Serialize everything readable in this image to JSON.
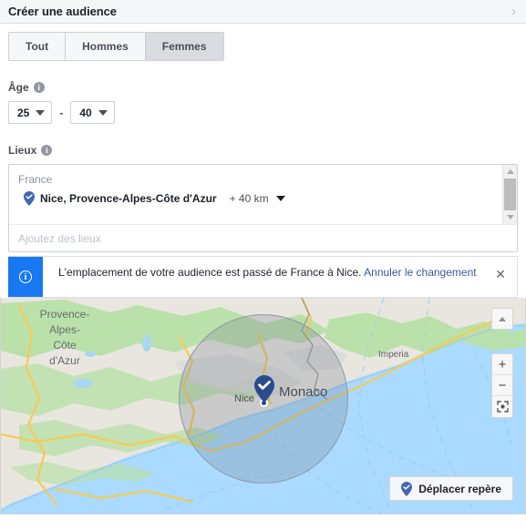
{
  "header": {
    "title": "Créer une audience",
    "expand_icon": "chevron-right-icon",
    "chevron": "›"
  },
  "gender_tabs": {
    "items": [
      {
        "label": "Tout",
        "active": false
      },
      {
        "label": "Hommes",
        "active": false
      },
      {
        "label": "Femmes",
        "active": true
      }
    ]
  },
  "age": {
    "label": "Âge",
    "info_icon": "info-icon",
    "info_glyph": "i",
    "min": "25",
    "max": "40",
    "separator": "-"
  },
  "locations": {
    "label": "Lieux",
    "info_icon": "info-icon",
    "info_glyph": "i",
    "country_group": "France",
    "selected": {
      "pin_icon": "location-pin-check-icon",
      "name": "Nice, Provence-Alpes-Côte d'Azur",
      "radius": "+ 40 km"
    },
    "input_placeholder": "Ajoutez des lieux",
    "input_value": ""
  },
  "notice": {
    "icon": "info-circle-icon",
    "icon_glyph": "i",
    "text": "L'emplacement de votre audience est passé de France à Nice.",
    "link": "Annuler le changement",
    "close_icon": "close-icon",
    "close_glyph": "✕",
    "accent_color": "#1778f2",
    "link_color": "#385898"
  },
  "map": {
    "labels": {
      "region": "Provence-\nAlpes-\nCôte\nd'Azur",
      "city_nice": "Nice",
      "city_monaco": "Monaco",
      "city_imperia": "Imperia"
    },
    "marker": {
      "icon": "map-pin-check-icon",
      "color": "#2b4b8f"
    },
    "radius_overlay": {
      "visible": true,
      "radius_label": "+ 40 km"
    },
    "controls": {
      "pan_up_icon": "chevron-up-icon",
      "zoom_in": "+",
      "zoom_out": "−",
      "recenter_icon": "recenter-icon"
    },
    "move_pin_button": {
      "icon": "location-pin-check-icon",
      "label": "Déplacer repère"
    }
  }
}
